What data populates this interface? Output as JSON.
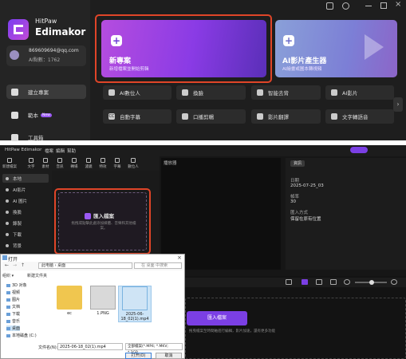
{
  "launcher": {
    "brand_top": "HitPaw",
    "brand_name": "Edimakor",
    "email": "869609694@qq.com",
    "credits": "AI點數：1762",
    "nav": [
      {
        "label": "建立專案"
      },
      {
        "label": "範本",
        "badge": "New"
      },
      {
        "label": "工具箱"
      }
    ],
    "new_project": {
      "title": "新專案",
      "subtitle": "新增檔案並開始剪輯"
    },
    "ai_generator": {
      "title": "AI影片產生器",
      "subtitle": "AI繪畫或圖本轉視頻"
    },
    "tools_row1": [
      "AI數位人",
      "換臉",
      "智能去背",
      "AI影片"
    ],
    "tools_row2": [
      "自動字幕",
      "口播剪輯",
      "影片翻譯",
      "文字轉語音"
    ],
    "tool_icons_row2": [
      "CC"
    ]
  },
  "editor": {
    "app_title": "HitPaw Edimakor",
    "menu": [
      "檔案",
      "編輯",
      "幫助"
    ],
    "toolbar": [
      "新建檔案",
      "文字",
      "素材",
      "音訊",
      "轉場",
      "濾鏡",
      "特效",
      "字幕",
      "數位人"
    ],
    "side": [
      "本地",
      "AI影片",
      "AI 圖片",
      "換臉",
      "錄製",
      "下載",
      "背景"
    ],
    "import_label": "匯入檔案",
    "import_hint": "拖拽或點擊此處添加媒體、音樂和其他檔案。",
    "player_header": "播放器",
    "props_tab": "資訊",
    "props": [
      {
        "label": "日期",
        "value": "2025-07-25_03"
      },
      {
        "label": "幀率",
        "value": "30"
      },
      {
        "label": "匯入方式",
        "value": "保留在原有位置"
      }
    ],
    "timeline_add": "匯入檔案",
    "timeline_hint": "拖曳檔案至時間軸進行編輯，影片加速，還有更多功能"
  },
  "dialog": {
    "title": "打开",
    "path": "此电脑 › 桌面",
    "search_placeholder": "在 桌面 中搜索",
    "organize": "组织 ▾",
    "new_folder": "新建文件夹",
    "sidebar": [
      "3D 对象",
      "视频",
      "图片",
      "文档",
      "下载",
      "音乐",
      "桌面",
      "本地磁盘 (C:)"
    ],
    "files": [
      {
        "name": "ec",
        "kind": "folder"
      },
      {
        "name": "1.PNG",
        "kind": "png"
      },
      {
        "name": "2025-06-18_02(1).mp4",
        "kind": "mp4"
      }
    ],
    "filename_label": "文件名(N):",
    "filename_value": "2025-06-18_02(1).mp4",
    "filetype": "全部檔案(*.MP4; *.MKV; *.3GP...",
    "open_button": "打开(O)",
    "cancel_button": "取消"
  },
  "colors": {
    "accent": "#8a3be5",
    "highlight": "#e04528"
  }
}
